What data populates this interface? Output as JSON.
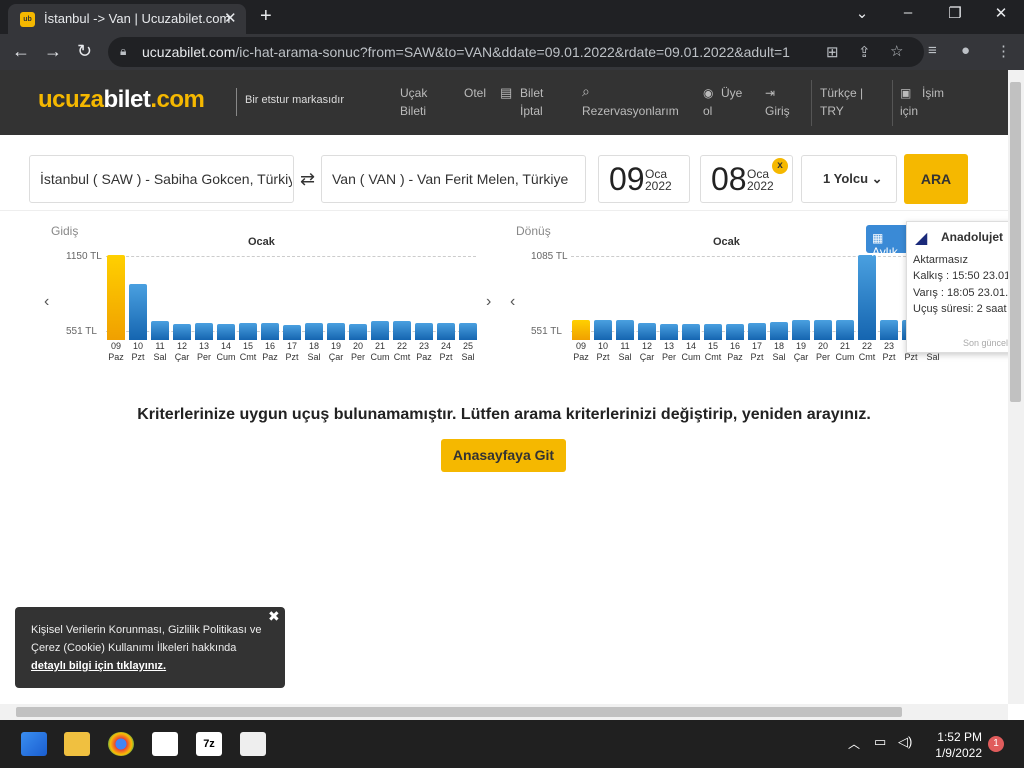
{
  "browser": {
    "tab_title": "İstanbul -> Van | Ucuzabilet.com",
    "url_host": "ucuzabilet.com",
    "url_path": "/ic-hat-arama-sonuc?from=SAW&to=VAN&ddate=09.01.2022&rdate=09.01.2022&adult=1"
  },
  "header": {
    "logo_a": "ucuza",
    "logo_b": "bilet",
    "logo_c": ".com",
    "tagline": "Bir etstur markasıdır",
    "nav": [
      "Uçak Bileti",
      "Otel",
      "Bilet İptal",
      "Rezervasyonlarım",
      "Üye ol",
      "Giriş",
      "Türkçe | TRY",
      "İşim için"
    ]
  },
  "search": {
    "from": "İstanbul ( SAW ) -  Sabiha Gokcen, Türkiye",
    "to": "Van ( VAN ) -  Van Ferit Melen, Türkiye",
    "depart_day": "09",
    "depart_month": "Oca",
    "depart_year": "2022",
    "return_day": "08",
    "return_month": "Oca",
    "return_year": "2022",
    "passengers": "1 Yolcu",
    "search_button": "ARA",
    "clear": "x"
  },
  "chart_data": [
    {
      "type": "bar",
      "title": "Gidiş",
      "month": "Ocak",
      "max_label": "1150 TL",
      "min_label": "551 TL",
      "ylim": [
        551,
        1150
      ],
      "days": [
        "09",
        "10",
        "11",
        "12",
        "13",
        "14",
        "15",
        "16",
        "17",
        "18",
        "19",
        "20",
        "21",
        "22",
        "23",
        "24",
        "25"
      ],
      "weekdays": [
        "Paz",
        "Pzt",
        "Sal",
        "Çar",
        "Per",
        "Cum",
        "Cmt",
        "Paz",
        "Pzt",
        "Sal",
        "Çar",
        "Per",
        "Cum",
        "Cmt",
        "Paz",
        "Pzt",
        "Sal"
      ],
      "values": [
        1150,
        920,
        620,
        600,
        605,
        600,
        610,
        605,
        595,
        605,
        605,
        600,
        620,
        625,
        605,
        605,
        605
      ],
      "selected_index": 0
    },
    {
      "type": "bar",
      "title": "Dönüş",
      "month": "Ocak",
      "max_label": "1085 TL",
      "min_label": "551 TL",
      "ylim": [
        551,
        1085
      ],
      "days": [
        "09",
        "10",
        "11",
        "12",
        "13",
        "14",
        "15",
        "16",
        "17",
        "18",
        "19",
        "20",
        "21",
        "22",
        "23",
        "24",
        "25"
      ],
      "weekdays": [
        "Paz",
        "Pzt",
        "Sal",
        "Çar",
        "Per",
        "Cum",
        "Cmt",
        "Paz",
        "Pzt",
        "Sal",
        "Çar",
        "Per",
        "Cum",
        "Cmt",
        "Pzt",
        "Pzt",
        "Sal"
      ],
      "values": [
        625,
        625,
        625,
        600,
        595,
        595,
        595,
        595,
        600,
        605,
        625,
        625,
        625,
        1085,
        625,
        625,
        625
      ],
      "selected_index": 0
    }
  ],
  "aylik_label": "Aylık",
  "popup": {
    "airline": "Anadolujet",
    "type": "Aktarmasız",
    "departure": "Kalkış : 15:50 23.01.",
    "arrival": "Varış : 18:05 23.01.",
    "duration": "Uçuş süresi: 2 saat",
    "footer": "Son güncel"
  },
  "message": "Kriterlerinize uygun uçuş bulunamamıştır. Lütfen arama kriterlerinizi değiştirip, yeniden arayınız.",
  "home_button": "Anasayfaya Git",
  "cookie": {
    "text": "Kişisel Verilerin Korunması, Gizlilik Politikası ve Çerez (Cookie) Kullanımı İlkeleri hakkında",
    "link": "detaylı bilgi için tıklayınız."
  },
  "taskbar": {
    "time": "1:52 PM",
    "date": "1/9/2022",
    "notifications": "1"
  }
}
